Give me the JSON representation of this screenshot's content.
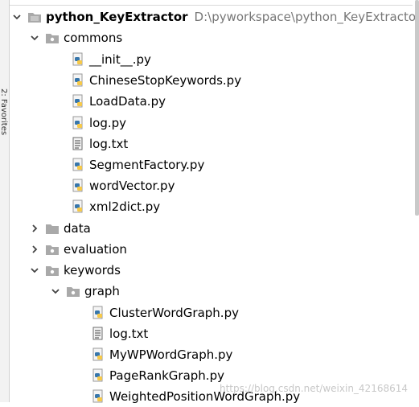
{
  "left_strip": {
    "text": "2: Favorites"
  },
  "project": {
    "name": "python_KeyExtractor",
    "path": "D:\\pyworkspace\\python_KeyExtractor"
  },
  "commons": {
    "label": "commons",
    "files": [
      "__init__.py",
      "ChineseStopKeywords.py",
      "LoadData.py",
      "log.py",
      "log.txt",
      "SegmentFactory.py",
      "wordVector.py",
      "xml2dict.py"
    ]
  },
  "data_folder": {
    "label": "data"
  },
  "evaluation_folder": {
    "label": "evaluation"
  },
  "keywords": {
    "label": "keywords",
    "graph": {
      "label": "graph",
      "files": [
        "ClusterWordGraph.py",
        "log.txt",
        "MyWPWordGraph.py",
        "PageRankGraph.py",
        "WeightedPositionWordGraph.py"
      ]
    }
  },
  "watermark": "https://blog.csdn.net/weixin_42168614",
  "colors": {
    "folder": "#a9a9a9",
    "python_blue": "#3776ab",
    "python_yellow": "#f7c948",
    "text_file": "#6b6b6b"
  }
}
